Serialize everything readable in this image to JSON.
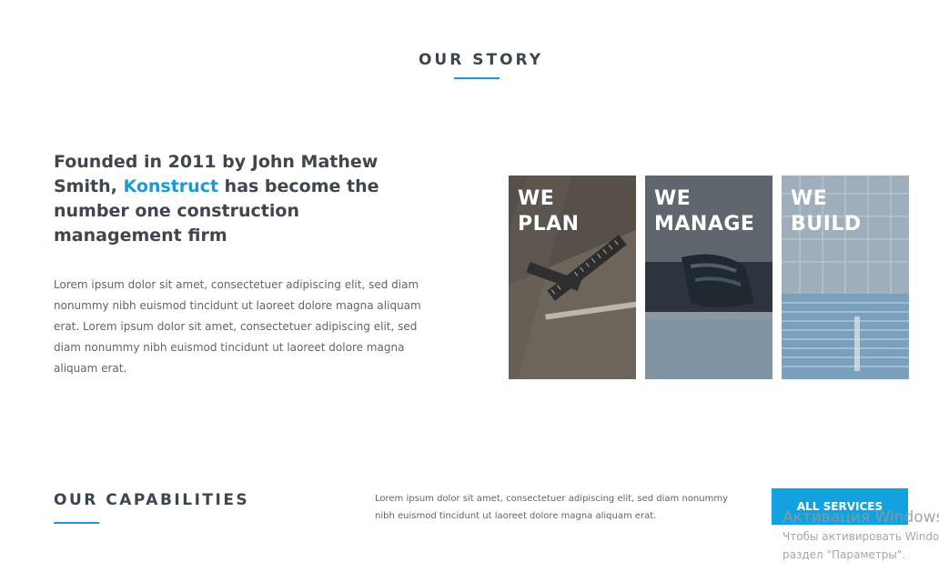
{
  "story": {
    "title": "OUR STORY",
    "heading_pre": "Founded in 2011 by John Mathew Smith, ",
    "heading_brand": "Konstruct",
    "heading_post": " has become the number one construction management firm",
    "body": "Lorem ipsum dolor sit amet, consectetuer adipiscing elit, sed diam nonummy nibh euismod tincidunt ut laoreet dolore magna aliquam erat. Lorem ipsum dolor sit amet, consectetuer adipiscing elit, sed diam nonummy nibh euismod tincidunt ut laoreet dolore magna aliquam erat."
  },
  "panels": [
    {
      "line1": "WE",
      "line2": "PLAN",
      "image": "tools-on-blueprint"
    },
    {
      "line1": "WE",
      "line2": "MANAGE",
      "image": "hands-on-laptop"
    },
    {
      "line1": "WE",
      "line2": "BUILD",
      "image": "glass-building-facade"
    }
  ],
  "capabilities": {
    "title": "OUR CAPABILITIES",
    "body": "Lorem ipsum dolor sit amet, consectetuer adipiscing elit, sed diam nonummy nibh euismod tincidunt ut laoreet dolore magna aliquam erat.",
    "button_label": "ALL SERVICES"
  },
  "watermark": {
    "title": "Активация Windows",
    "line1": "Чтобы активировать Windows,",
    "line2": "раздел \"Параметры\"."
  },
  "colors": {
    "accent": "#1b9ad6",
    "button": "#12a2e0",
    "heading": "#3d4650"
  }
}
